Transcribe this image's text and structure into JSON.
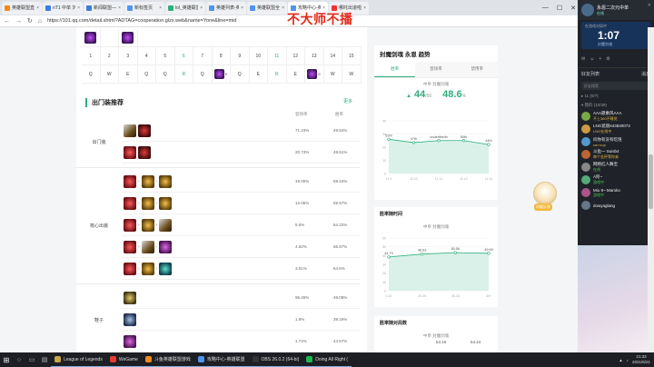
{
  "browser": {
    "tabs": [
      {
        "label": "英雄联盟直播_lol直播_斗",
        "color": "#f38a1b"
      },
      {
        "label": "nT1 中单 刘青松 bu(t)",
        "color": "#3c7be0"
      },
      {
        "label": "新闻联盟——金色殿堂中",
        "color": "#3c7be0"
      },
      {
        "label": "新标签页",
        "color": "#4f95f0"
      },
      {
        "label": "lol_英雄联盟",
        "color": "#2fae7b"
      },
      {
        "label": "英雄列表-英雄联盟官方网",
        "color": "#4f95f0"
      },
      {
        "label": "英雄联盟全球官方网站-",
        "color": "#4f95f0"
      },
      {
        "label": "攻略中心-英雄联盟官方",
        "color": "#4f95f0",
        "active": true
      },
      {
        "label": "哪吒出道啦",
        "color": "#e33"
      }
    ],
    "url": "https://101.qq.com/detail.shtml?ADTAG=cooperation.glzx.web&name=Yone&line=mid",
    "overlay": "不大师不播"
  },
  "skills": {
    "numbers": [
      "1",
      "2",
      "3",
      "4",
      "5",
      "6",
      "7",
      "8",
      "9",
      "10",
      "11",
      "12",
      "13",
      "14",
      "15"
    ],
    "order": [
      "Q",
      "W",
      "E",
      "Q",
      "Q",
      "R",
      "Q",
      "E",
      "Q",
      "E",
      "R",
      "E",
      "E",
      "W",
      "W"
    ]
  },
  "outfit": {
    "title": "出门装推荐",
    "more": "更多",
    "col_pick": "登场率",
    "col_win": "胜率",
    "groups": [
      {
        "label": "出门装",
        "rows": [
          {
            "items": [
              "blade",
              "pot"
            ],
            "pick": "71.23%",
            "win": "49.54%"
          },
          {
            "items": [
              "red",
              "pot"
            ],
            "pick": "20.73%",
            "win": "48.61%"
          }
        ]
      },
      {
        "label": "核心出装",
        "rows": [
          {
            "items": [
              "red",
              "gold",
              "gold"
            ],
            "pick": "19.05%",
            "win": "59.44%"
          },
          {
            "items": [
              "red",
              "gold",
              "gold"
            ],
            "pick": "12.06%",
            "win": "59.57%"
          },
          {
            "items": [
              "red",
              "gold",
              "blade"
            ],
            "pick": "5.6%",
            "win": "64.22%"
          },
          {
            "items": [
              "red",
              "blade",
              "purple"
            ],
            "pick": "4.62%",
            "win": "66.67%"
          },
          {
            "items": [
              "red",
              "gold",
              "teal"
            ],
            "pick": "3.01%",
            "win": "64.6%"
          }
        ]
      },
      {
        "label": "鞋子",
        "rows": [
          {
            "items": [
              "boot"
            ],
            "pick": "96.46%",
            "win": "49.09%"
          },
          {
            "items": [
              "boot2"
            ],
            "pick": "1.8%",
            "win": "39.19%"
          },
          {
            "items": [
              "purple"
            ],
            "pick": "1.74%",
            "win": "44.57%"
          }
        ]
      }
    ]
  },
  "trend": {
    "title": "封魔剑魂 永恩 趋势",
    "tabs": [
      "胜率",
      "登场率",
      "禁用率"
    ],
    "subtitle": "中单 封魔剑魂",
    "rank": "44",
    "rank_total": "/56",
    "rate": "48.6",
    "rate_unit": "%",
    "chart_data": {
      "type": "area",
      "x": [
        "11.9",
        "11.10",
        "11.11",
        "11.12",
        "11.13"
      ],
      "values": [
        52,
        47,
        50,
        50,
        44
      ],
      "point_labels": [
        "52th",
        "47th",
        "underfrtedh",
        "50th",
        "44th"
      ],
      "ylabels": [
        "40",
        "30",
        "20",
        "10",
        "0"
      ]
    }
  },
  "winrate_chart": {
    "title": "胜率随时间",
    "subtitle": "中单 封魔剑魂",
    "chart_data": {
      "type": "area",
      "x": [
        "0-20",
        "20-25",
        "25-30",
        "30+"
      ],
      "values": [
        44.79,
        48.63,
        50.56,
        49.69
      ],
      "ylabels": [
        "60",
        "50",
        "40",
        "30",
        "20",
        "10",
        "0"
      ]
    }
  },
  "third_chart": {
    "title": "胜率随对局数",
    "subtitle": "中单 封魔剑魂",
    "labels": [
      "54.16",
      "54.24"
    ]
  },
  "mascot": {
    "badge": "问题反馈"
  },
  "sidebar": {
    "name": "永恩二次元中单",
    "sub": "在线",
    "status": "自走棋",
    "timer_label": "在游戏对局中",
    "timer": "1:07",
    "timer_sub": "封魔剑魂",
    "tabs": [
      "好友列表",
      "消息"
    ],
    "search": "好友搜索",
    "group1": "▸ 11 (0/7)",
    "group2": "▾ 我的 (10/39)",
    "friends": [
      {
        "name": "AAA愿乘风AAA",
        "status": "不上360不睡觉",
        "color": "#7a4",
        "y": true
      },
      {
        "name": "LNG遮丽643840073",
        "status": "LNG在线中",
        "color": "#c94",
        "y": true
      },
      {
        "name": "问你有没有吃饱",
        "status": "ran·nop",
        "color": "#59c",
        "y": true
      },
      {
        "name": "斗鱼一 Suisb4",
        "status": "每个金杯等你来",
        "color": "#b63",
        "y": true
      },
      {
        "name": "网络红人舞宝",
        "status": "在线",
        "color": "#888",
        "y": false
      },
      {
        "name": "A阿~",
        "status": "游戏中",
        "color": "#5a7",
        "y": false
      },
      {
        "name": "Miu 9~ Maroko",
        "status": "游戏中",
        "color": "#a58",
        "y": false
      },
      {
        "name": "dowyaglang",
        "status": "",
        "color": "#678",
        "y": false
      }
    ]
  },
  "taskbar": {
    "apps": [
      {
        "label": "League of Legends",
        "color": "#c8a74a"
      },
      {
        "label": "WeGame",
        "color": "#e63b2e"
      },
      {
        "label": "斗鱼英雄联盟游戏",
        "color": "#f38a1b"
      },
      {
        "label": "攻略中心-英雄联盟",
        "color": "#4f95f0"
      },
      {
        "label": "OBS 26.0.2 (64-bi)",
        "color": "#333"
      },
      {
        "label": "Doing All Right (",
        "color": "#1db954"
      }
    ],
    "time": "21:33",
    "date": "2021/6/21"
  }
}
